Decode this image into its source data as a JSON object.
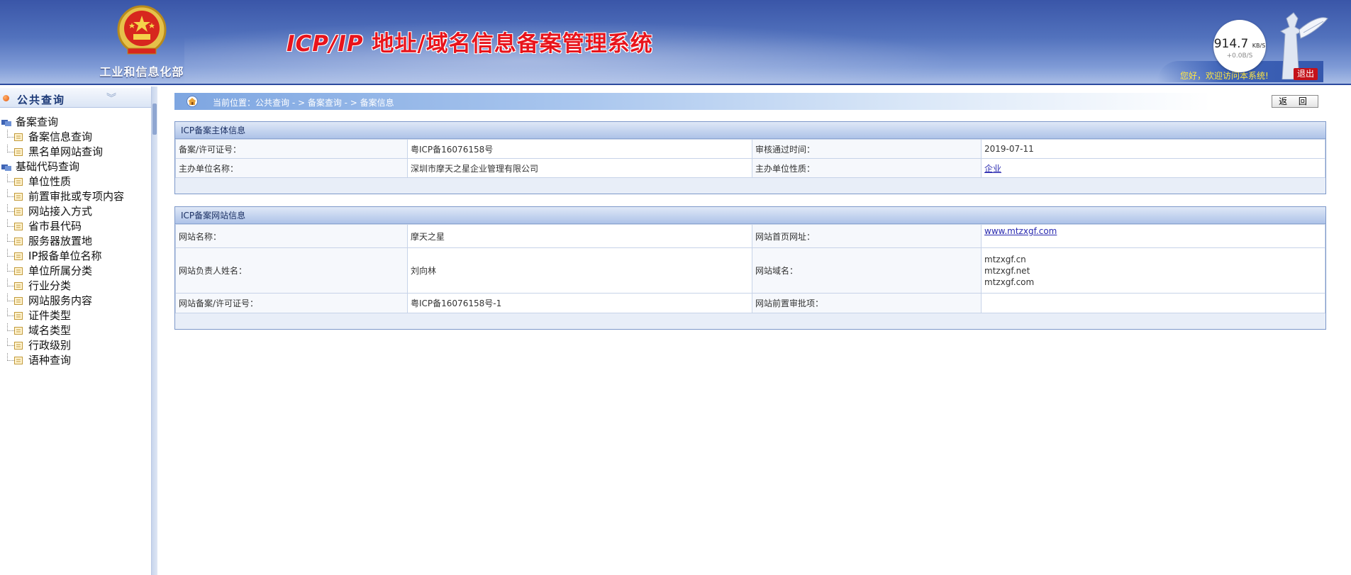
{
  "header": {
    "ministry": "工业和信息化部",
    "title_latin": "ICP/IP",
    "title_rest": " 地址/域名信息备案管理系统",
    "welcome": "您好，欢迎访问本系统!",
    "logout": "退出",
    "speed_value": "914.7",
    "speed_unit": "KB/S",
    "speed_sub": "+0.0B/S"
  },
  "sidebar": {
    "heading": "公共查询",
    "groups": [
      {
        "label": "备案查询",
        "items": [
          "备案信息查询",
          "黑名单网站查询"
        ]
      },
      {
        "label": "基础代码查询",
        "items": [
          "单位性质",
          "前置审批或专项内容",
          "网站接入方式",
          "省市县代码",
          "服务器放置地",
          "IP报备单位名称",
          "单位所属分类",
          "行业分类",
          "网站服务内容",
          "证件类型",
          "域名类型",
          "行政级别",
          "语种查询"
        ]
      }
    ]
  },
  "breadcrumb": {
    "text": "当前位置：公共查询  - >  备案查询  - >  备案信息"
  },
  "back_button": "返 回",
  "subject_panel": {
    "title": "ICP备案主体信息",
    "license_label": "备案/许可证号：",
    "license_value": "粤ICP备16076158号",
    "approve_time_label": "审核通过时间：",
    "approve_time_value": "2019-07-11",
    "org_name_label": "主办单位名称：",
    "org_name_value": "深圳市摩天之星企业管理有限公司",
    "org_type_label": "主办单位性质：",
    "org_type_value": "企业"
  },
  "site_panel": {
    "title": "ICP备案网站信息",
    "site_name_label": "网站名称：",
    "site_name_value": "摩天之星",
    "homepage_label": "网站首页网址：",
    "homepage_value": "www.mtzxgf.com",
    "owner_label": "网站负责人姓名：",
    "owner_value": "刘向林",
    "domain_label": "网站域名：",
    "domains": [
      "mtzxgf.cn",
      "mtzxgf.net",
      "mtzxgf.com"
    ],
    "site_license_label": "网站备案/许可证号：",
    "site_license_value": "粤ICP备16076158号-1",
    "pre_approval_label": "网站前置审批项：",
    "pre_approval_value": ""
  },
  "colors": {
    "header_blue": "#3a56a8",
    "title_red": "#e8141c",
    "welcome_yellow": "#ffe640",
    "panel_border": "#7d98c9"
  }
}
